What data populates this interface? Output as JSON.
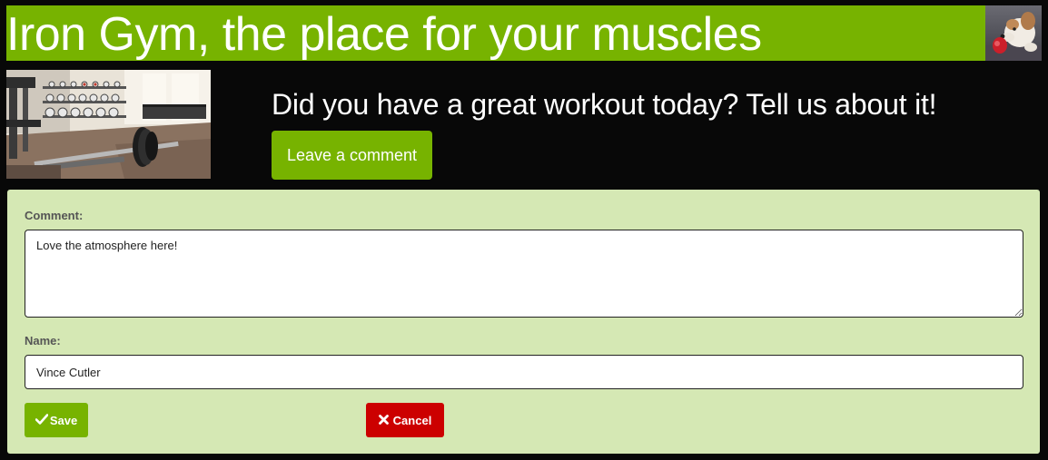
{
  "header": {
    "title": "Iron Gym, the place for your muscles",
    "accent_color": "#77b300",
    "avatar_icon": "dog-avatar-photo"
  },
  "hero": {
    "image_icon": "gym-weights-photo",
    "question": "Did you have a great workout today? Tell us about it!",
    "leave_comment_label": "Leave a comment"
  },
  "form": {
    "background_color": "#d5e8b4",
    "comment_label": "Comment:",
    "comment_value": "Love the atmosphere here!",
    "name_label": "Name:",
    "name_value": "Vince Cutler",
    "save_icon": "checkmark-icon",
    "save_label": "Save",
    "cancel_icon": "times-icon",
    "cancel_label": "Cancel",
    "save_color": "#77b300",
    "cancel_color": "#cc0000"
  }
}
